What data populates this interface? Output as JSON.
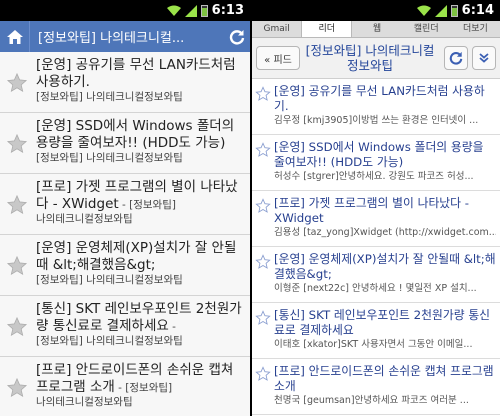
{
  "left_status": {
    "time": "6:13"
  },
  "right_status": {
    "time": "6:14"
  },
  "left": {
    "header_title": "[정보와팁] 나의테크니컬...",
    "items": [
      {
        "title": "[운영] 공유기를 무선 LAN카드처럼 사용하기.",
        "source": "[정보와팁] 나의테크니컬정보와팁"
      },
      {
        "title": "[운영] SSD에서 Windows 폴더의 용량을 줄여보자!! (HDD도 가능)",
        "source": "[정보와팁] 나의테크니컬정보와팁"
      },
      {
        "title": "[프로] 가젯 프로그램의 별이 나타났다 - XWidget",
        "source": "[정보와팁] 나의테크니컬정보와팁",
        "source_inline": " - [정보와팁]",
        "source_rest": "나의테크니컬정보와팁"
      },
      {
        "title": "[운영] 운영체제(XP)설치가 잘 안될때 &lt;해결했음&gt;",
        "source": "[정보와팁] 나의테크니컬정보와팁"
      },
      {
        "title": "[통신] SKT 레인보우포인트 2천원가량 통신료로 결제하세요",
        "source": "[정보와팁] 나의테크니컬정보와팁",
        "source_inline": " - ",
        "source_rest": "[정보와팁] 나의테크니컬정보와팁"
      },
      {
        "title": "[프로] 안드로이드폰의 손쉬운 캡쳐 프로그램 소개",
        "source": "나의테크니컬정보와팁",
        "source_inline": " - [정보와팁]",
        "source_rest": "나의테크니컬정보와팁"
      }
    ]
  },
  "right": {
    "tabs": [
      "Gmail",
      "리더",
      "웹",
      "캘린더",
      "더보기"
    ],
    "feed_button": "« 피드",
    "header_title": "[정보와팁] 나의테크니컬정보와팁",
    "items": [
      {
        "title": "[운영] 공유기를 무선 LAN카드처럼 사용하기.",
        "snippet": "김우정 [kmj3905]이방법 쓰는 환경은 인터넷이 ..."
      },
      {
        "title": "[운영] SSD에서 Windows 폴더의 용량을 줄여보자!! (HDD도 가능)",
        "snippet": "허성수 [stgrer]안녕하세요. 강원도 파코즈 허성..."
      },
      {
        "title": "[프로] 가젯 프로그램의 별이 나타났다 - XWidget",
        "snippet": "김용성 [taz_yong]Xwidget (http://xwidget.com..."
      },
      {
        "title": "[운영] 운영체제(XP)설치가 잘 안될때 &lt;해결했음&gt;",
        "snippet": "이형준 [next22c] 안녕하세요 ! 몇일전 XP 설치..."
      },
      {
        "title": "[통신] SKT 레인보우포인트 2천원가량 통신료로 결제하세요",
        "snippet": "이태호 [xkator]SKT 사용자면서 그동안 이메일..."
      },
      {
        "title": "[프로] 안드로이드폰의 손쉬운 캡쳐 프로그램 소개",
        "snippet": "천명국 [geumsan]안녕하세요 파코즈 여러분 ..."
      }
    ]
  },
  "colors": {
    "header_blue": "#4e76b9",
    "link_blue": "#263f8f",
    "star_gray": "#c8c8c8",
    "battery_green": "#7dc242"
  },
  "icons": [
    "home-icon",
    "refresh-icon",
    "star-icon",
    "wifi-icon",
    "signal-icon",
    "battery-icon",
    "chevron-down-icon"
  ]
}
